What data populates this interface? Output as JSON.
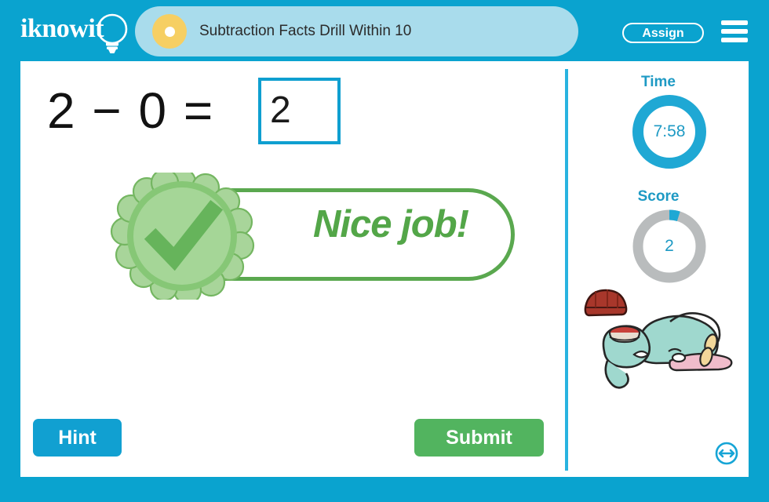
{
  "brand": {
    "logo_text": "iknowit",
    "logo_icon": "lightbulb-icon"
  },
  "header": {
    "lesson_title": "Subtraction Facts Drill Within 10",
    "assign_label": "Assign",
    "menu_icon": "hamburger-menu-icon",
    "bullet_icon": "lesson-bullet-icon",
    "bar_color": "#0aa3cf",
    "pill_color": "#a9dcec",
    "bullet_color": "#f6cf63"
  },
  "problem": {
    "expression": "2 − 0 =",
    "operand_left": "2",
    "operator": "−",
    "operand_right": "0",
    "equals": "=",
    "answer_value": "2",
    "answer_placeholder": "",
    "answer_border_color": "#0f9fd0"
  },
  "feedback": {
    "message": "Nice job!",
    "icon": "green-check-seal-icon",
    "color": "#53a648",
    "visible": true
  },
  "sidebar": {
    "time": {
      "label": "Time",
      "value": "7:58",
      "ring_color": "#1fa8d4",
      "progress_percent": 100
    },
    "score": {
      "label": "Score",
      "value": "2",
      "ring_color": "#1fa8d4",
      "track_color": "#b9bcbd",
      "progress_percent": 5
    },
    "mascot": {
      "icon": "sleeping-elephant-mascot",
      "hat_icon": "red-beanie-hat-icon",
      "body_color": "#9fd8ce",
      "hat_color": "#b03b2e"
    },
    "resize_icon": "horizontal-resize-icon"
  },
  "actions": {
    "hint_label": "Hint",
    "hint_color": "#11a0d1",
    "submit_label": "Submit",
    "submit_color": "#52b45f"
  }
}
